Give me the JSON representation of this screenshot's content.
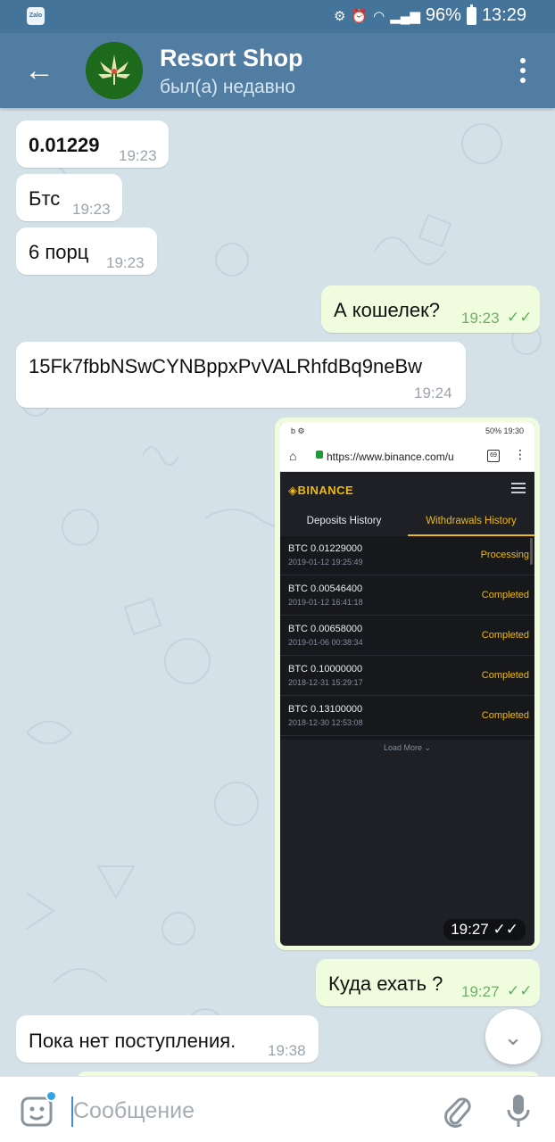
{
  "status_bar": {
    "app_icon_text": "Zalo",
    "battery": "96%",
    "time": "13:29"
  },
  "header": {
    "title": "Resort Shop",
    "subtitle": "был(а) недавно"
  },
  "messages": [
    {
      "text": "0.01229",
      "time": "19:23",
      "dir": "in"
    },
    {
      "text": "Бтс",
      "time": "19:23",
      "dir": "in"
    },
    {
      "text": "6 порц",
      "time": "19:23",
      "dir": "in"
    },
    {
      "text": "А кошелек?",
      "time": "19:23",
      "dir": "out"
    },
    {
      "text": "15Fk7fbbNSwCYNBppxPvVALRhfdBq9neBw",
      "time": "19:24",
      "dir": "in"
    },
    {
      "text": "Куда ехать ?",
      "time": "19:27",
      "dir": "out"
    },
    {
      "text": "Пока нет поступления.",
      "time": "19:38",
      "dir": "in"
    }
  ],
  "screenshot": {
    "time": "19:27",
    "status_time": "19:30",
    "status_battery": "50%",
    "url": "https://www.binance.com/u",
    "tabs_count": "69",
    "logo": "BINANCE",
    "tab_deposits": "Deposits History",
    "tab_withdrawals": "Withdrawals History",
    "rows": [
      {
        "amount": "BTC  0.01229000",
        "date": "2019-01-12 19:25:49",
        "status": "Processing"
      },
      {
        "amount": "BTC  0.00546400",
        "date": "2019-01-12 16:41:18",
        "status": "Completed"
      },
      {
        "amount": "BTC  0.00658000",
        "date": "2019-01-06 00:38:34",
        "status": "Completed"
      },
      {
        "amount": "BTC  0.10000000",
        "date": "2018-12-31 15:29:17",
        "status": "Completed"
      },
      {
        "amount": "BTC  0.13100000",
        "date": "2018-12-30 12:53:08",
        "status": "Completed"
      }
    ],
    "load_more": "Load More"
  },
  "input": {
    "placeholder": "Сообщение"
  },
  "colors": {
    "header": "#517da2",
    "status_bar": "#44749a",
    "outgoing_bubble": "#effdde",
    "incoming_bubble": "#ffffff",
    "binance_yellow": "#f0b90b"
  },
  "icons": {
    "back": "arrow-left-icon",
    "menu": "more-vertical-icon",
    "sticker": "sticker-icon",
    "attach": "paperclip-icon",
    "mic": "microphone-icon",
    "scroll_down": "chevron-down-icon"
  }
}
